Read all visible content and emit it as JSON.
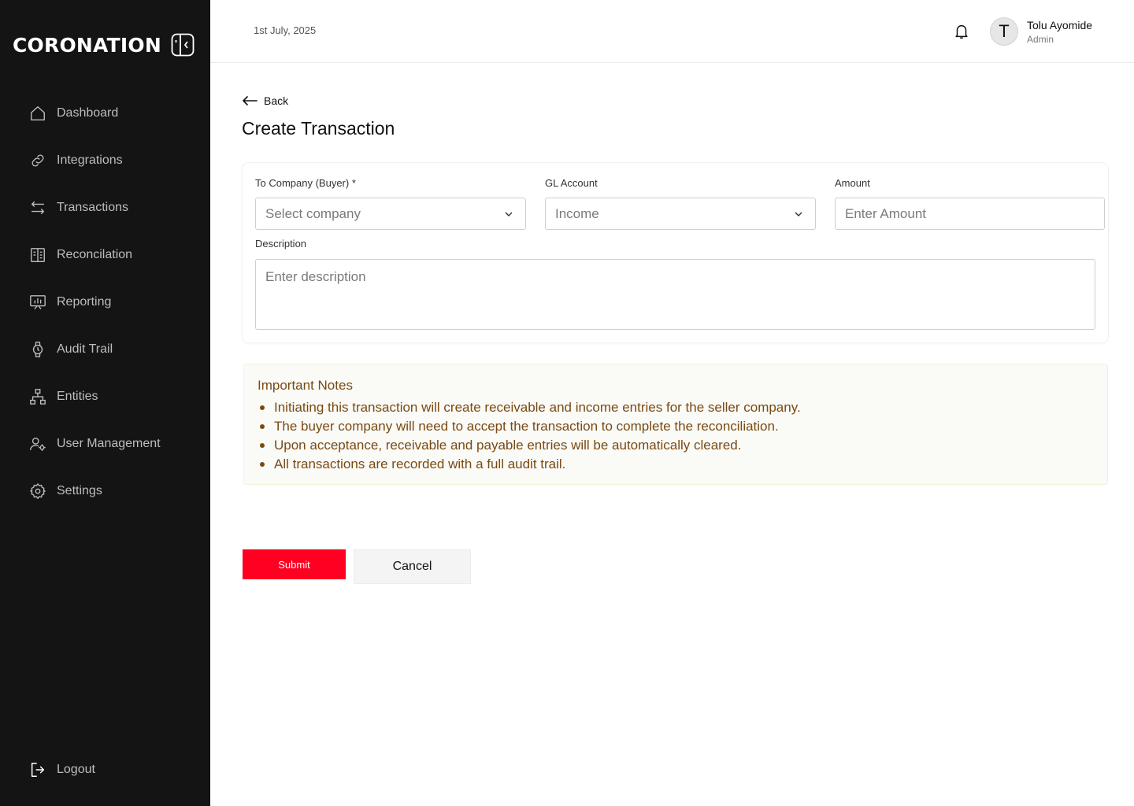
{
  "brand": {
    "name": "CORONATION"
  },
  "sidebar": {
    "items": [
      {
        "label": "Dashboard",
        "icon": "home-icon"
      },
      {
        "label": "Integrations",
        "icon": "link-icon"
      },
      {
        "label": "Transactions",
        "icon": "arrows-swap-icon"
      },
      {
        "label": "Reconcilation",
        "icon": "ledger-icon"
      },
      {
        "label": "Reporting",
        "icon": "presentation-chart-icon"
      },
      {
        "label": "Audit Trail",
        "icon": "watch-icon"
      },
      {
        "label": "Entities",
        "icon": "hierarchy-icon"
      },
      {
        "label": "User Management",
        "icon": "user-gear-icon"
      },
      {
        "label": "Settings",
        "icon": "gear-icon"
      }
    ],
    "logout_label": "Logout"
  },
  "header": {
    "date": "1st July, 2025",
    "user": {
      "initial": "T",
      "name": "Tolu Ayomide",
      "role": "Admin"
    }
  },
  "page": {
    "back_label": "Back",
    "title": "Create Transaction"
  },
  "form": {
    "company": {
      "label": "To Company (Buyer) *",
      "value": "Select company"
    },
    "gl_account": {
      "label": "GL Account",
      "value": "Income"
    },
    "amount": {
      "label": "Amount",
      "placeholder": "Enter Amount"
    },
    "description": {
      "label": "Description",
      "placeholder": "Enter description"
    }
  },
  "notes": {
    "title": "Important Notes",
    "items": [
      "Initiating this transaction will create receivable and income entries for the seller company.",
      "The buyer company will need to accept the transaction to complete the reconciliation.",
      "Upon acceptance, receivable and payable entries will be automatically cleared.",
      "All transactions are recorded with a full audit trail."
    ]
  },
  "actions": {
    "submit_label": "Submit",
    "cancel_label": "Cancel"
  },
  "colors": {
    "sidebar_bg": "#141414",
    "primary": "#ff0022",
    "notes_text": "#7a4a12"
  }
}
